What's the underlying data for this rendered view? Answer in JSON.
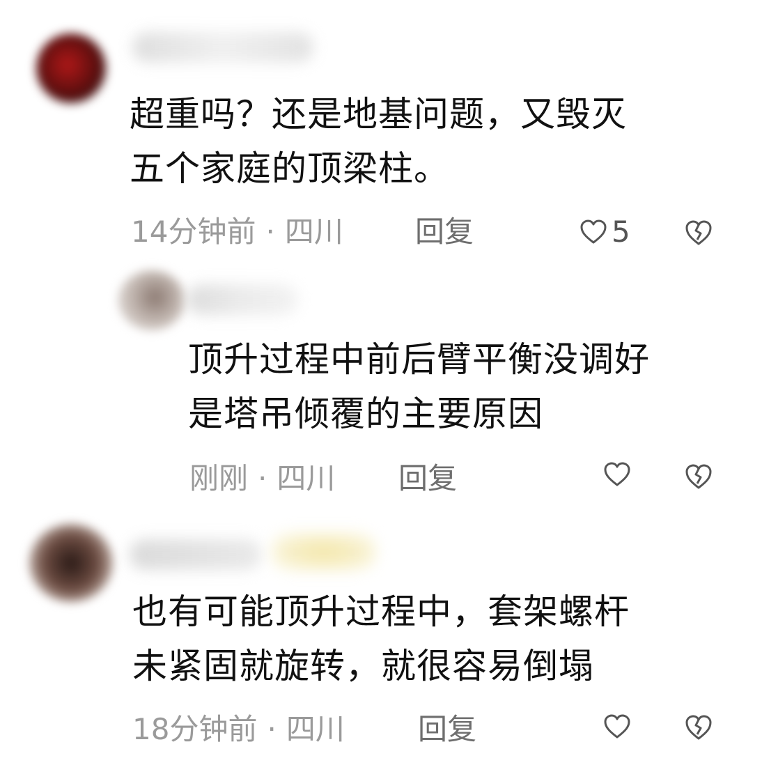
{
  "comments": [
    {
      "text_line1": "超重吗？还是地基问题，又毁灭",
      "text_line2": "五个家庭的顶梁柱。",
      "time": "14分钟前",
      "location": "四川",
      "reply_label": "回复",
      "like_count": "5",
      "avatar_color": "#7a1414",
      "is_reply": false
    },
    {
      "text_line1": "顶升过程中前后臂平衡没调好",
      "text_line2": "是塔吊倾覆的主要原因",
      "time": "刚刚",
      "location": "四川",
      "reply_label": "回复",
      "like_count": "",
      "avatar_color": "#8c7a72",
      "is_reply": true
    },
    {
      "text_line1": "也有可能顶升过程中，套架螺杆",
      "text_line2": "未紧固就旋转，就很容易倒塌",
      "time": "18分钟前",
      "location": "四川",
      "reply_label": "回复",
      "like_count": "",
      "avatar_color": "#4a2e26",
      "is_reply": false
    }
  ],
  "meta_separator": "·",
  "icons": {
    "like": "heart-outline-icon",
    "dislike": "broken-heart-outline-icon"
  },
  "colors": {
    "text": "#111111",
    "meta": "#9a9a9a",
    "reply": "#6e6e6e",
    "icon": "#555555"
  }
}
